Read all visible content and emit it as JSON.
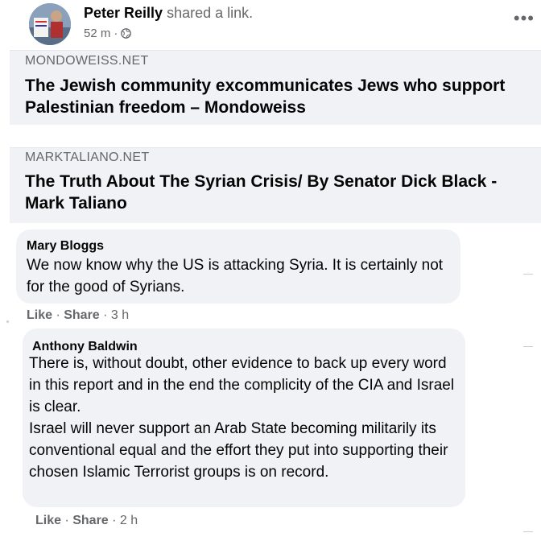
{
  "post": {
    "author": "Peter Reilly",
    "action": " shared a link.",
    "time": "52 m",
    "separator": "·",
    "privacy_icon": "globe-icon",
    "more_label": "•••"
  },
  "links": [
    {
      "domain": "MONDOWEISS.NET",
      "title": "The Jewish community excommunicates Jews who support Palestinian freedom – Mondoweiss"
    },
    {
      "domain": "MARKTALIANO.NET",
      "title": "The Truth About The Syrian Crisis/ By Senator Dick Black - Mark Taliano"
    }
  ],
  "comments": [
    {
      "name": "Mary Bloggs",
      "text": "We now know why the US is attacking Syria. It is certainly not for the good of Syrians.",
      "like": "Like",
      "share": "Share",
      "time": "3 h"
    },
    {
      "name": "Anthony Baldwin",
      "text": "There is, without doubt, other evidence to back up every word in this report and in the end the complicity of the CIA and Israel is clear.\nIsrael will never support an Arab State becoming militarily its conventional equal and the effort they put into supporting their chosen Islamic Terrorist groups is on record.",
      "like": "Like",
      "share": "Share",
      "time": "2 h"
    }
  ],
  "colors": {
    "bubble": "#f0f2f5",
    "secondary_text": "#65676b",
    "primary_text": "#050505"
  }
}
